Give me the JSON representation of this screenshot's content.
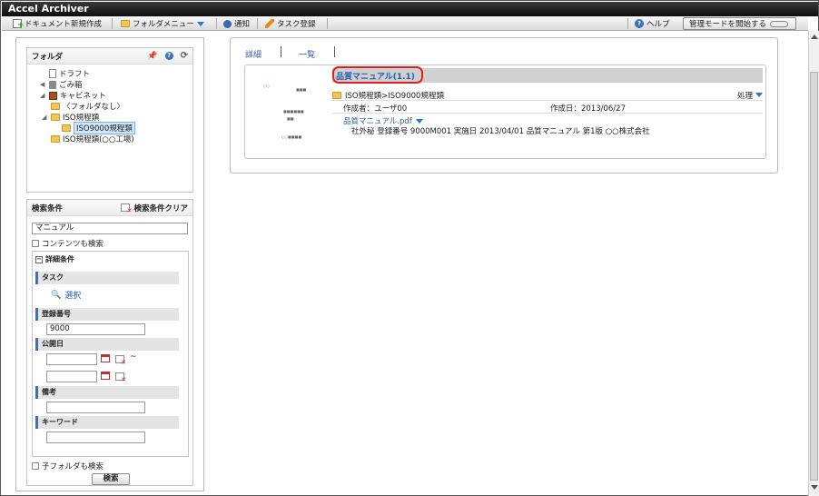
{
  "app": {
    "title": "Accel Archiver"
  },
  "toolbar": {
    "new_doc": "ドキュメント新規作成",
    "folder_menu": "フォルダメニュー",
    "notify": "通知",
    "task_register": "タスク登録",
    "help": "ヘルプ",
    "admin_mode": "管理モードを開始する"
  },
  "folder_panel": {
    "title": "フォルダ",
    "tree": [
      {
        "label": "ドラフト"
      },
      {
        "label": "ごみ箱"
      },
      {
        "label": "キャビネット"
      },
      {
        "label": "〈フォルダなし〉"
      },
      {
        "label": "ISO規程類"
      },
      {
        "label": "ISO9000規程類"
      },
      {
        "label": "ISO規程類(○○工場)"
      }
    ]
  },
  "search": {
    "title": "検索条件",
    "clear": "検索条件クリア",
    "keyword": "マニュアル",
    "contents_search": "コンテンツも検索",
    "detail_title": "詳細条件",
    "task_label": "タスク",
    "select_link": "選択",
    "reg_no_label": "登録番号",
    "reg_no_value": "9000",
    "pub_date_label": "公開日",
    "tilde": "~",
    "note_label": "備考",
    "keyword_label": "キーワード",
    "subfolder_search": "子フォルダも検索",
    "search_button": "検索"
  },
  "view_tabs": {
    "detail": "詳細",
    "list": "一覧"
  },
  "result": {
    "title": "品質マニュアル(1.1)",
    "path": "ISO規程類>ISO9000規程類",
    "action": "処理",
    "creator": "作成者：ユーザ00",
    "created": "作成日：2013/06/27",
    "file": "品質マニュアル.pdf",
    "attributes": "社外秘 登録番号 9000M001 実施日 2013/04/01 品質マニュアル 第1版 ○○株式会社"
  },
  "colors": {
    "accent": "#2a74c9",
    "highlight": "#e02020",
    "titlebar": "#1a1a1a"
  }
}
